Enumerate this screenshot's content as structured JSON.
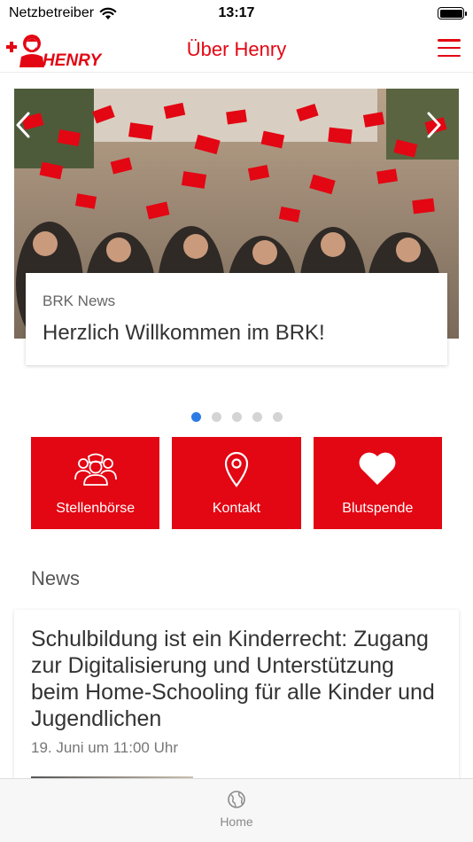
{
  "status_bar": {
    "carrier": "Netzbetreiber",
    "time": "13:17",
    "battery_level": 1.0
  },
  "header": {
    "logo_text": "HENRY",
    "title": "Über Henry",
    "menu_icon": "hamburger-menu-icon"
  },
  "carousel": {
    "kicker": "BRK News",
    "title": "Herzlich Willkommen im BRK!",
    "slide_count": 5,
    "active_index": 0,
    "prev_icon": "chevron-left-icon",
    "next_icon": "chevron-right-icon"
  },
  "tiles": [
    {
      "label": "Stellenbörse",
      "icon": "people-icon"
    },
    {
      "label": "Kontakt",
      "icon": "location-pin-icon"
    },
    {
      "label": "Blutspende",
      "icon": "heart-icon"
    }
  ],
  "news": {
    "section_title": "News",
    "articles": [
      {
        "title": "Schulbildung ist ein Kinderrecht: Zugang zur Digitalisierung und Unterstützung beim Home-Schooling für alle Kinder und Jugendlichen",
        "date": "19. Juni um 11:00 Uhr"
      }
    ]
  },
  "tab_bar": {
    "items": [
      {
        "label": "Home",
        "icon": "globe-icon"
      }
    ]
  },
  "colors": {
    "brand_red": "#e30613",
    "active_dot": "#2c7be5",
    "inactive_dot": "#d4d4d4"
  }
}
